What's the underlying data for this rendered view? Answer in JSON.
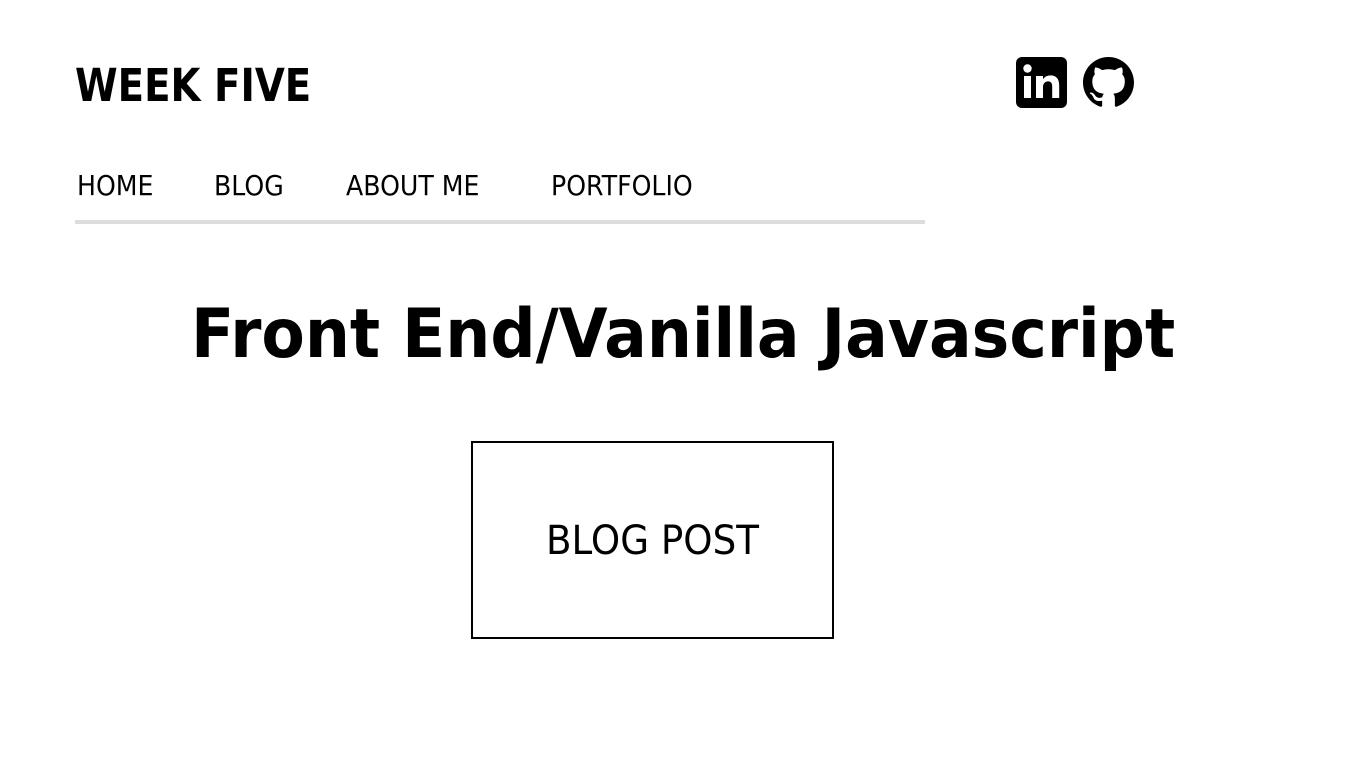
{
  "header": {
    "site_title": "WEEK FIVE",
    "social": [
      {
        "icon": "linkedin-icon",
        "label": "in"
      },
      {
        "icon": "github-icon"
      }
    ]
  },
  "nav": {
    "items": [
      {
        "label": "HOME"
      },
      {
        "label": "BLOG"
      },
      {
        "label": "ABOUT ME"
      },
      {
        "label": "PORTFOLIO"
      }
    ]
  },
  "main": {
    "heading": "Front End/Vanilla Javascript",
    "card": {
      "label": "BLOG POST"
    }
  },
  "colors": {
    "text": "#000000",
    "background": "#ffffff",
    "nav_underline": "#dddddd"
  }
}
